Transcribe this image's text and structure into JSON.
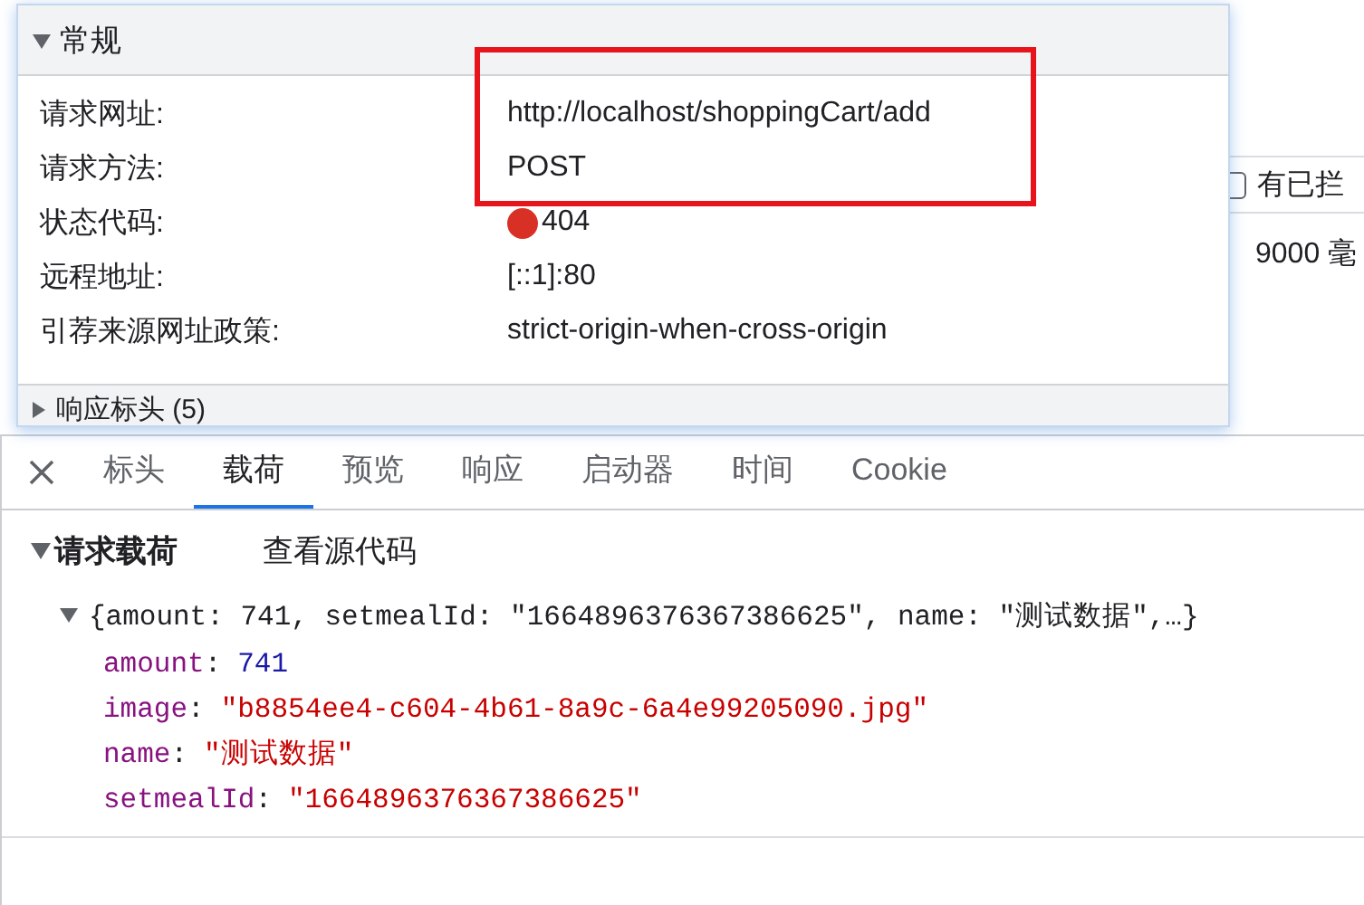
{
  "background": {
    "checkbox": {
      "label": "有已拦",
      "checked": false
    },
    "cell": "9000 毫"
  },
  "general": {
    "title": "常规",
    "expanded": true,
    "rows": [
      {
        "label": "请求网址:",
        "value": "http://localhost/shoppingCart/add",
        "highlighted": true
      },
      {
        "label": "请求方法:",
        "value": "POST",
        "highlighted": true
      },
      {
        "label": "状态代码:",
        "value": "404",
        "highlighted": false,
        "color": "#d93025"
      },
      {
        "label": "远程地址:",
        "value": "[::1]:80",
        "highlighted": false
      },
      {
        "label": "引荐来源网址政策:",
        "value": "strict-origin-when-cross-origin",
        "highlighted": false
      }
    ],
    "response_headers": {
      "label": "响应标头 (5)",
      "expanded": false
    }
  },
  "tabs": [
    {
      "label": "标头",
      "selected": false
    },
    {
      "label": "载荷",
      "selected": true
    },
    {
      "label": "预览",
      "selected": false
    },
    {
      "label": "响应",
      "selected": false
    },
    {
      "label": "启动器",
      "selected": false
    },
    {
      "label": "时间",
      "selected": false
    },
    {
      "label": "Cookie",
      "selected": false
    }
  ],
  "payload": {
    "title": "请求载荷",
    "expanded": true,
    "view_source": "查看源代码",
    "object": {
      "summary": "{amount: 741, setmealId: \"1664896376367386625\", name: \"测试数据\",…}",
      "expanded": true,
      "properties": [
        {
          "key": "amount",
          "separator": ":",
          "value": "741",
          "kind": "number"
        },
        {
          "key": "image",
          "separator": ":",
          "value": "\"b8854ee4-c604-4b61-8a9c-6a4e99205090.jpg\"",
          "kind": "string"
        },
        {
          "key": "name",
          "separator": ":",
          "value": "\"测试数据\"",
          "kind": "string"
        },
        {
          "key": "setmealId",
          "separator": ":",
          "value": "\"1664896376367386625\"",
          "kind": "string"
        }
      ]
    }
  }
}
